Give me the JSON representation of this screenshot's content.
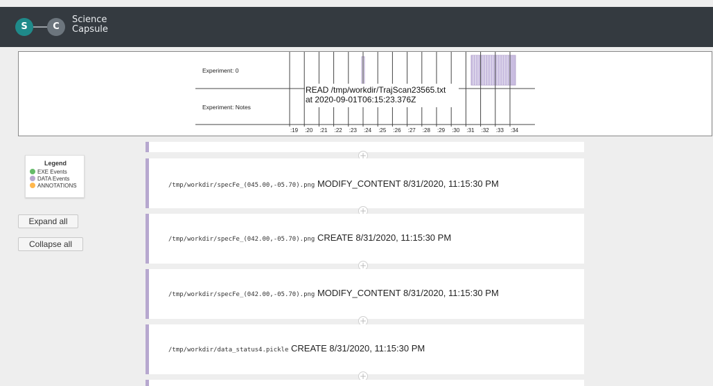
{
  "header": {
    "logo_s": "S",
    "logo_c": "C",
    "brand_line1": "Science",
    "brand_line2": "Capsule"
  },
  "timeline": {
    "rows": [
      "Experiment: 0",
      "Experiment: Notes"
    ],
    "ticks": [
      ":19",
      ":20",
      ":21",
      ":22",
      ":23",
      ":24",
      ":25",
      ":26",
      ":27",
      ":28",
      ":29",
      ":30",
      ":31",
      ":32",
      ":33",
      ":34"
    ],
    "tooltip_line1": "READ /tmp/workdir/TrajScan23565.txt",
    "tooltip_line2": "at 2020-09-01T06:15:23.376Z",
    "data_event_color": "#b7a8cf"
  },
  "legend": {
    "title": "Legend",
    "items": [
      {
        "label": "EXE Events",
        "color": "#66bb6a"
      },
      {
        "label": "DATA Events",
        "color": "#b7a8cf"
      },
      {
        "label": "ANNOTATIONS",
        "color": "#ffb74d"
      }
    ]
  },
  "controls": {
    "expand_all": "Expand all",
    "collapse_all": "Collapse all"
  },
  "events": [
    {
      "path": "/tmp/workdir/specFe_(045.00,-05.70).png",
      "action": "MODIFY_CONTENT",
      "timestamp": "8/31/2020, 11:15:30 PM"
    },
    {
      "path": "/tmp/workdir/specFe_(042.00,-05.70).png",
      "action": "CREATE",
      "timestamp": "8/31/2020, 11:15:30 PM"
    },
    {
      "path": "/tmp/workdir/specFe_(042.00,-05.70).png",
      "action": "MODIFY_CONTENT",
      "timestamp": "8/31/2020, 11:15:30 PM"
    },
    {
      "path": "/tmp/workdir/data_status4.pickle",
      "action": "CREATE",
      "timestamp": "8/31/2020, 11:15:30 PM"
    }
  ],
  "add_symbol": "+"
}
